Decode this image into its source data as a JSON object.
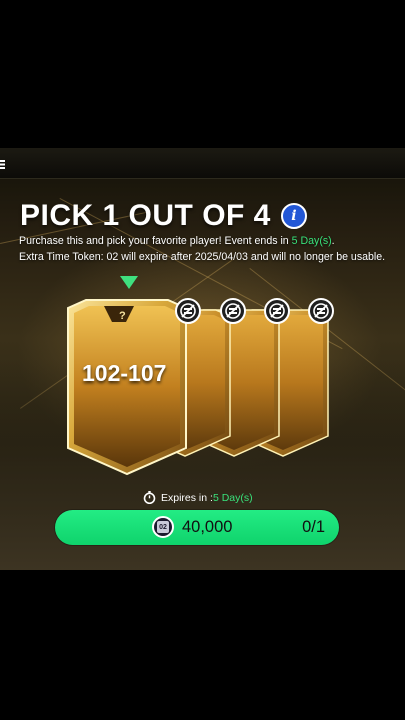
{
  "header": {
    "title": "PICK 1 OUT OF 4",
    "info_icon": "info-icon",
    "description_prefix": "Purchase this and pick your favorite player! Event ends in ",
    "description_highlight": "5 Day(s)",
    "description_suffix": ".",
    "token_notice": "Extra Time Token: 02 will expire after 2025/04/03 and will no longer be usable."
  },
  "cards": {
    "rating_range": "102-107",
    "selected_icon": "pointer-triangle-icon",
    "hidden_mark": "?",
    "locked_icon": "no-swap-icon"
  },
  "purchase": {
    "expires_label": "Expires in : ",
    "expires_value": "5 Day(s)",
    "timer_icon": "stopwatch-icon",
    "token_label": "02",
    "price": "40,000",
    "count": "0/1"
  },
  "colors": {
    "accent_green": "#19e076",
    "info_blue": "#2257d6",
    "card_gold": "#d9a93c"
  }
}
